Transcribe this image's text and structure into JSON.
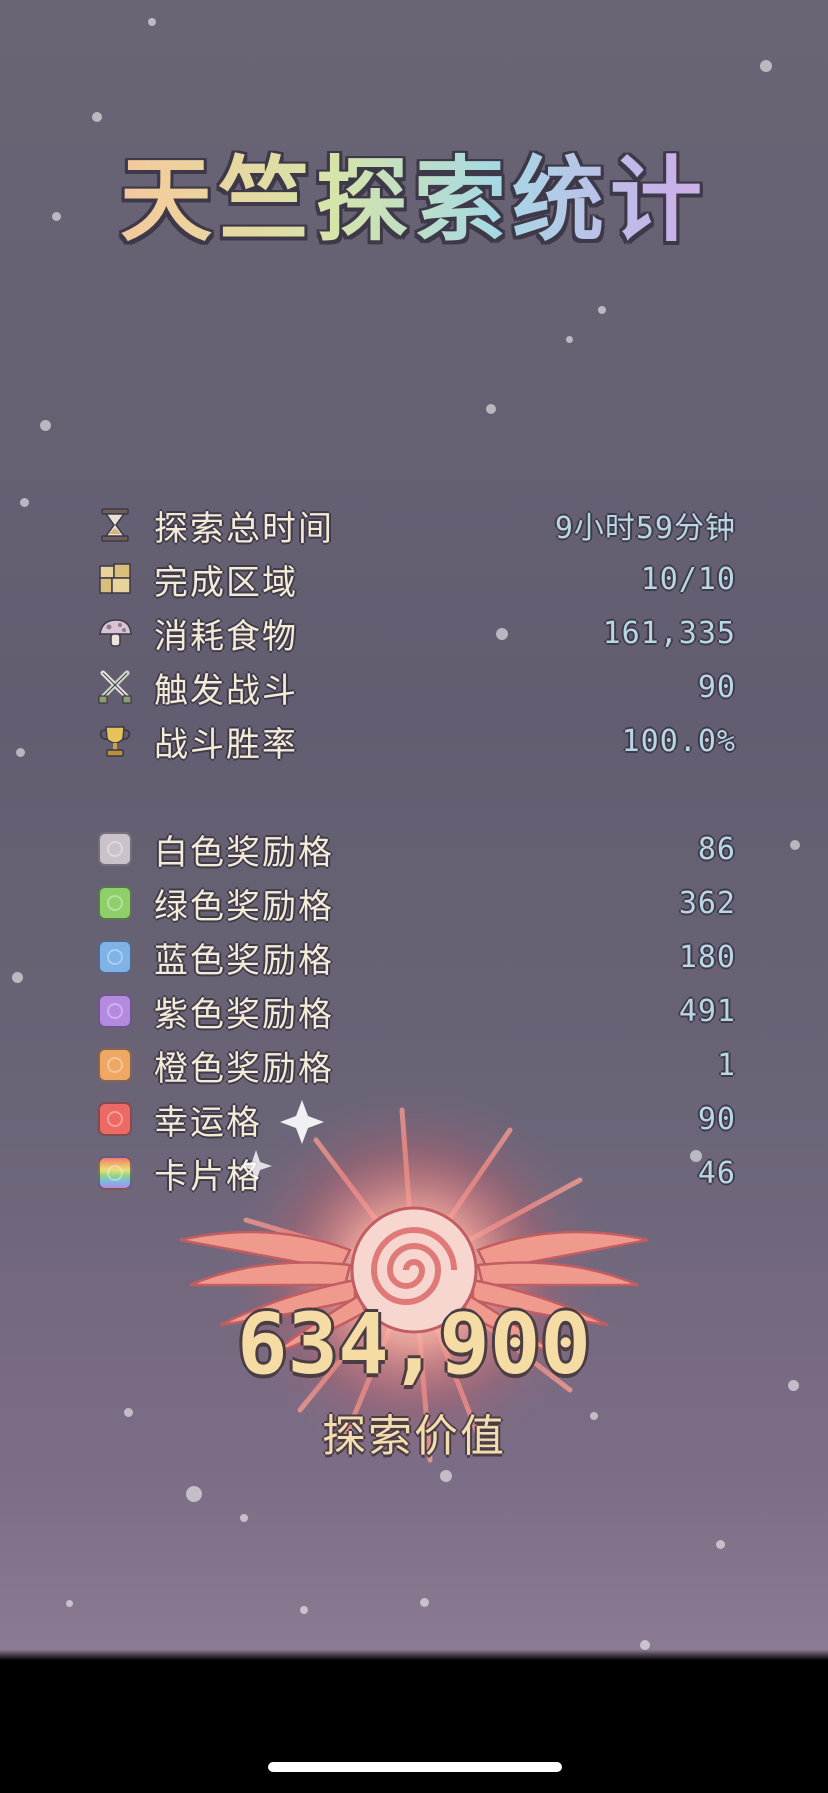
{
  "title": "天竺探索统计",
  "summary_stats": [
    {
      "icon": "hourglass-icon",
      "label": "探索总时间",
      "value": "9小时59分钟"
    },
    {
      "icon": "map-area-icon",
      "label": "完成区域",
      "value": "10/10"
    },
    {
      "icon": "mushroom-food-icon",
      "label": "消耗食物",
      "value": "161,335"
    },
    {
      "icon": "crossed-swords-icon",
      "label": "触发战斗",
      "value": "90"
    },
    {
      "icon": "trophy-icon",
      "label": "战斗胜率",
      "value": "100.0%"
    }
  ],
  "reward_stats": [
    {
      "icon": "white-tile-icon",
      "color": "#c9c3c9",
      "label": "白色奖励格",
      "value": "86"
    },
    {
      "icon": "green-tile-icon",
      "color": "#8fcf6a",
      "label": "绿色奖励格",
      "value": "362"
    },
    {
      "icon": "blue-tile-icon",
      "color": "#7fb2e6",
      "label": "蓝色奖励格",
      "value": "180"
    },
    {
      "icon": "purple-tile-icon",
      "color": "#b489e0",
      "label": "紫色奖励格",
      "value": "491"
    },
    {
      "icon": "orange-tile-icon",
      "color": "#efa764",
      "label": "橙色奖励格",
      "value": "1"
    },
    {
      "icon": "red-tile-icon",
      "color": "#ec6a63",
      "label": "幸运格",
      "value": "90"
    },
    {
      "icon": "rainbow-tile-icon",
      "color": "rainbow",
      "label": "卡片格",
      "value": "46"
    }
  ],
  "total": {
    "value": "634,900",
    "label": "探索价值"
  },
  "colors": {
    "background": "#655f71",
    "label_text": "#f3ead8",
    "value_text": "#b9d6e6",
    "total_text": "#f5dca4"
  }
}
